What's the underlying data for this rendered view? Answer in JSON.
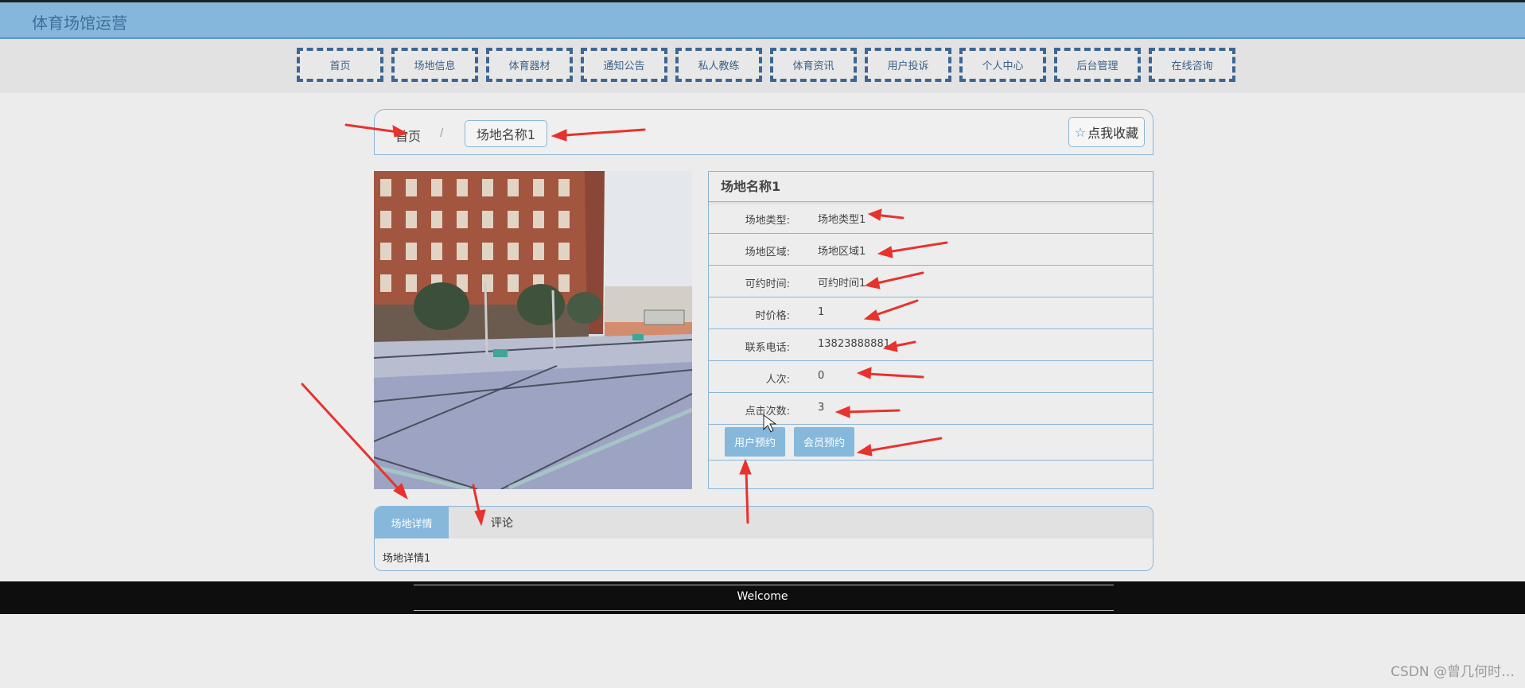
{
  "header": {
    "site_title": "体育场馆运营"
  },
  "nav": {
    "items": [
      {
        "label": "首页"
      },
      {
        "label": "场地信息"
      },
      {
        "label": "体育器材"
      },
      {
        "label": "通知公告"
      },
      {
        "label": "私人教练"
      },
      {
        "label": "体育资讯"
      },
      {
        "label": "用户投诉"
      },
      {
        "label": "个人中心"
      },
      {
        "label": "后台管理"
      },
      {
        "label": "在线咨询"
      }
    ]
  },
  "breadcrumb": {
    "home": "首页",
    "separator": "/",
    "current": "场地名称1"
  },
  "favorite": {
    "label": "点我收藏",
    "icon": "star-outline-icon"
  },
  "venue": {
    "name": "场地名称1",
    "fields": [
      {
        "label": "场地类型:",
        "value": "场地类型1"
      },
      {
        "label": "场地区域:",
        "value": "场地区域1"
      },
      {
        "label": "可约时间:",
        "value": "可约时间1"
      },
      {
        "label": "时价格:",
        "value": "1"
      },
      {
        "label": "联系电话:",
        "value": "13823888881"
      },
      {
        "label": "人次:",
        "value": "0"
      },
      {
        "label": "点击次数:",
        "value": "3"
      }
    ],
    "buttons": {
      "user_booking": "用户预约",
      "member_booking": "会员预约"
    }
  },
  "tabs": {
    "items": [
      {
        "label": "场地详情"
      },
      {
        "label": "评论"
      }
    ],
    "content": "场地详情1"
  },
  "footer": {
    "text": "Welcome"
  },
  "watermark": "CSDN @曾几何时…",
  "colors": {
    "accent": "#86b8dc",
    "header": "#85b7dc",
    "nav_border": "#3d6694",
    "annotation_arrow": "#e8322e"
  }
}
